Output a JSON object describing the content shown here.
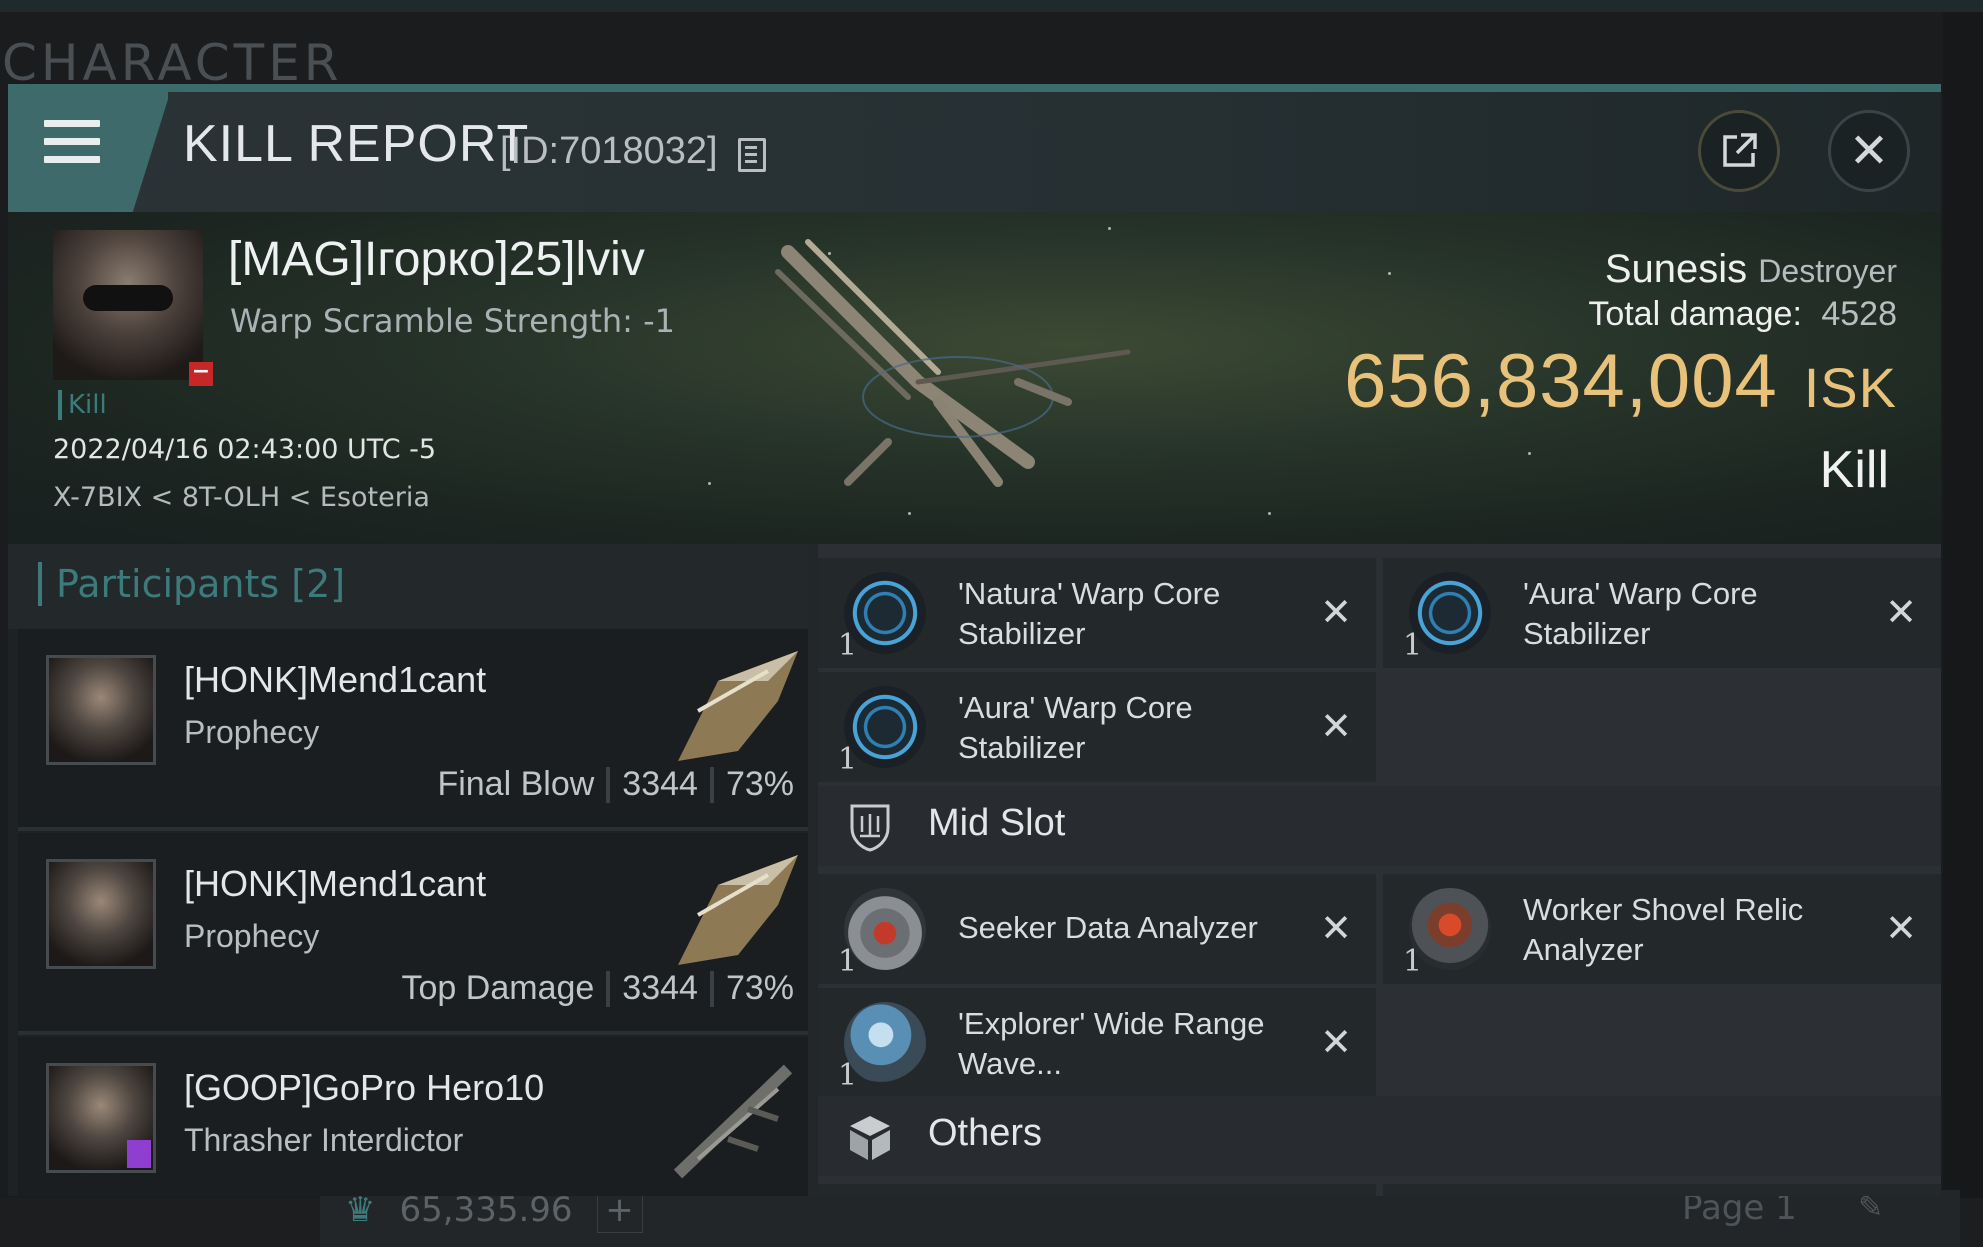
{
  "background": {
    "section_title": "CHARACTER",
    "ticker_value": "65,335.96",
    "ticker_plus": "+",
    "page_label": "Page 1",
    "edit_glyph": "✎"
  },
  "window": {
    "title": "KILL REPORT",
    "report_id": "[ID:7018032]",
    "share_glyph": "⇱",
    "close_glyph": "✕"
  },
  "victim": {
    "name": "[MAG]Ігорко]25]lviv",
    "detail": "Warp Scramble Strength: -1",
    "portrait_badge": "−",
    "kill_tag": "Kill",
    "timestamp": "2022/04/16 02:43:00 UTC -5",
    "location": "X-7BIX < 8T-OLH < Esoteria",
    "ship": "Sunesis",
    "ship_class": "Destroyer",
    "total_damage_label": "Total damage:",
    "total_damage": "4528",
    "isk_value": "656,834,004",
    "isk_unit": "ISK",
    "result": "Kill"
  },
  "participants": {
    "header": "Participants [2]",
    "rows": [
      {
        "name": "[HONK]Mend1cant",
        "ship": "Prophecy",
        "role": "Final Blow",
        "damage": "3344",
        "percent": "73%"
      },
      {
        "name": "[HONK]Mend1cant",
        "ship": "Prophecy",
        "role": "Top Damage",
        "damage": "3344",
        "percent": "73%"
      },
      {
        "name": "[GOOP]GoPro Hero10",
        "ship": "Thrasher Interdictor",
        "role": "",
        "damage": "",
        "percent": ""
      }
    ]
  },
  "fitting": {
    "low_slots": [
      {
        "qty": "1",
        "name": "'Natura' Warp Core Stabilizer",
        "icon": "warp-core-stabilizer-icon"
      },
      {
        "qty": "1",
        "name": "'Aura' Warp Core Stabilizer",
        "icon": "warp-core-stabilizer-icon"
      },
      {
        "qty": "1",
        "name": "'Aura' Warp Core Stabilizer",
        "icon": "warp-core-stabilizer-icon"
      }
    ],
    "mid_slot_label": "Mid Slot",
    "mid_slots": [
      {
        "qty": "1",
        "name": "Seeker Data Analyzer",
        "icon": "data-analyzer-icon"
      },
      {
        "qty": "1",
        "name": "Worker Shovel Relic Analyzer",
        "icon": "relic-analyzer-icon"
      },
      {
        "qty": "1",
        "name": "'Explorer' Wide Range Wave...",
        "icon": "scan-probe-launcher-icon"
      }
    ],
    "others_label": "Others",
    "remove_glyph": "✕"
  },
  "colors": {
    "accent_teal": "#3d7a7c",
    "isk_gold": "#e8c27a",
    "window_bg": "#23272a"
  }
}
